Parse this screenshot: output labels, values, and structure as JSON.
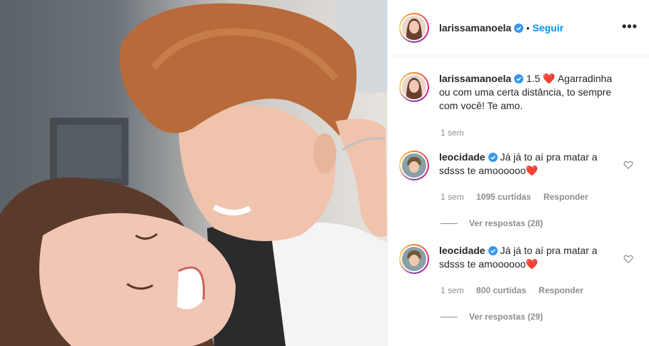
{
  "post": {
    "author": "larissamanoela",
    "follow_label": "Seguir",
    "separator": "•",
    "more_label": "•••"
  },
  "caption": {
    "author": "larissamanoela",
    "text": "1.5 ❤️ Agarradinha ou com uma certa distância, to sempre com você! Te amo.",
    "time": "1 sem"
  },
  "comments": [
    {
      "author": "leocidade",
      "text": "Já já to aí pra matar a sdsss te amoooooo❤️",
      "time": "1 sem",
      "likes": "1095 curtidas",
      "reply_label": "Responder",
      "view_replies": "Ver respostas (28)"
    },
    {
      "author": "leocidade",
      "text": "Já já to aí pra matar a sdsss te amoooooo❤️",
      "time": "1 sem",
      "likes": "800 curtidas",
      "reply_label": "Responder",
      "view_replies": "Ver respostas (29)"
    }
  ],
  "colors": {
    "accent": "#0095f6",
    "muted": "#8e8e8e",
    "verified": "#3897f0",
    "border": "#efefef"
  }
}
